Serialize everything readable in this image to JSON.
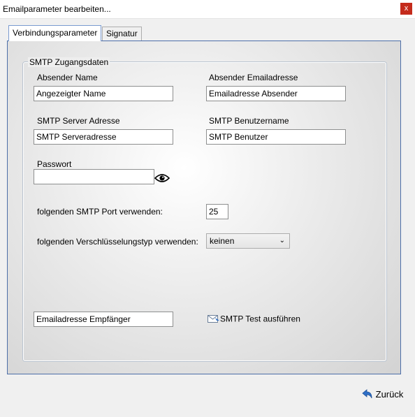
{
  "window": {
    "title": "Emailparameter bearbeiten...",
    "close_glyph": "x"
  },
  "tabs": [
    {
      "label": "Verbindungsparameter",
      "active": true
    },
    {
      "label": "Signatur",
      "active": false
    }
  ],
  "smtp_group": {
    "legend": "SMTP Zugangsdaten",
    "absender_name": {
      "label": "Absender Name",
      "value": "Angezeigter Name"
    },
    "absender_email": {
      "label": "Absender Emailadresse",
      "value": "Emailadresse Absender"
    },
    "server": {
      "label": "SMTP Server Adresse",
      "value": "SMTP Serveradresse"
    },
    "benutzer": {
      "label": "SMTP Benutzername",
      "value": "SMTP Benutzer"
    },
    "passwort": {
      "label": "Passwort",
      "value": "",
      "toggle_icon": "eye-icon"
    },
    "port": {
      "label": "folgenden SMTP Port verwenden:",
      "value": "25"
    },
    "encryption": {
      "label": "folgenden Verschlüsselungstyp verwenden:",
      "value": "keinen"
    },
    "recipient": {
      "value": "Emailadresse Empfänger"
    },
    "test_button": {
      "label": "SMTP Test ausführen",
      "icon": "mail-send-icon"
    }
  },
  "footer": {
    "back_label": "Zurück",
    "back_icon": "back-arrow-icon"
  },
  "colors": {
    "close": "#c42b1c",
    "tab_border": "#4c6ea8"
  }
}
